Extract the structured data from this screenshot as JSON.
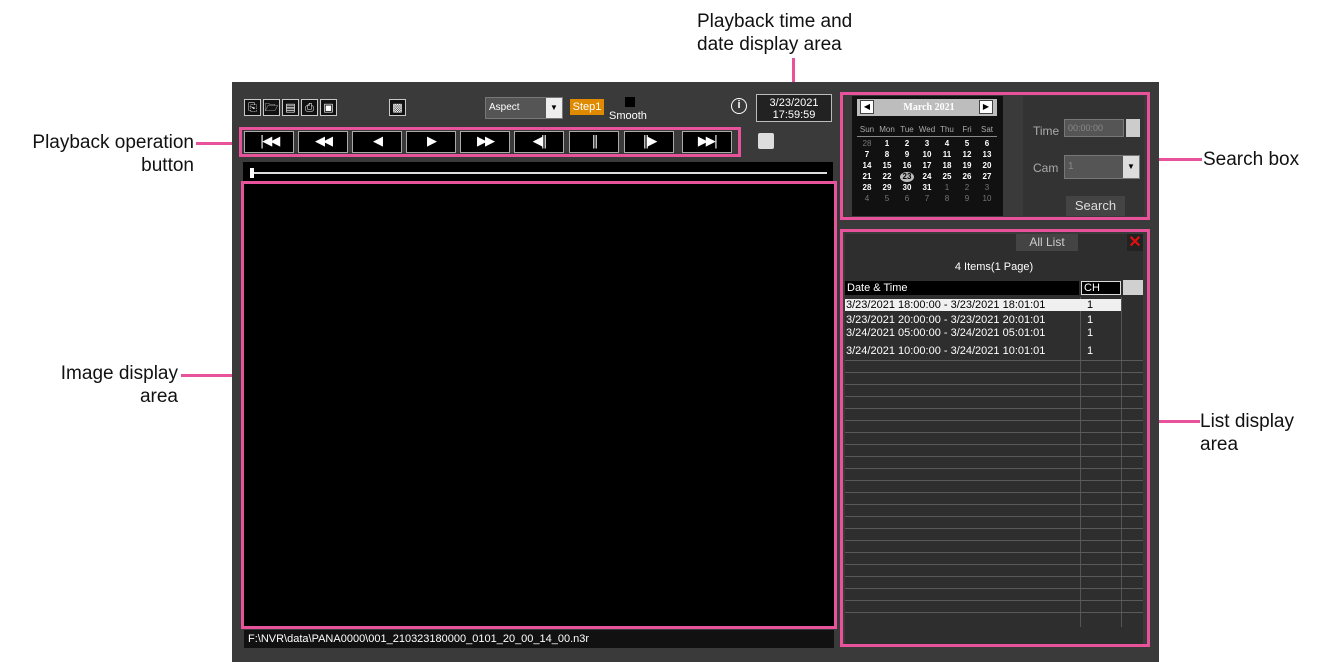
{
  "callouts": {
    "playback_time": [
      "Playback time and",
      "date display area"
    ],
    "playback_operation": [
      "Playback operation",
      "button"
    ],
    "image_display": [
      "Image display",
      "area"
    ],
    "search_box": "Search box",
    "list_display": [
      "List display",
      "area"
    ]
  },
  "toolbar": {
    "aspect_label": "Aspect",
    "step_label": "Step1",
    "smooth_label": "Smooth",
    "icons": [
      "open-recording-icon",
      "open-folder-icon",
      "save-icon",
      "print-icon",
      "fullscreen-icon",
      "snapshot-icon",
      "info-icon"
    ]
  },
  "datetime": {
    "date": "3/23/2021",
    "time": "17:59:59"
  },
  "playback_buttons": [
    "skip-to-start",
    "fast-rewind",
    "reverse-play",
    "play",
    "fast-forward",
    "frame-back",
    "pause",
    "frame-forward",
    "skip-to-end"
  ],
  "file_path": "F:\\NVR\\data\\PANA0000\\001_210323180000_0101_20_00_14_00.n3r",
  "calendar": {
    "month_label": "March 2021",
    "weekdays": [
      "Sun",
      "Mon",
      "Tue",
      "Wed",
      "Thu",
      "Fri",
      "Sat"
    ],
    "weeks": [
      [
        "28",
        "1",
        "2",
        "3",
        "4",
        "5",
        "6"
      ],
      [
        "7",
        "8",
        "9",
        "10",
        "11",
        "12",
        "13"
      ],
      [
        "14",
        "15",
        "16",
        "17",
        "18",
        "19",
        "20"
      ],
      [
        "21",
        "22",
        "23",
        "24",
        "25",
        "26",
        "27"
      ],
      [
        "28",
        "29",
        "30",
        "31",
        "1",
        "2",
        "3"
      ],
      [
        "4",
        "5",
        "6",
        "7",
        "8",
        "9",
        "10"
      ]
    ],
    "selected_day": "23"
  },
  "search": {
    "time_label": "Time",
    "time_value": "00:00:00",
    "cam_label": "Cam",
    "cam_value": "1",
    "search_label": "Search"
  },
  "list": {
    "tab_label": "All List",
    "count_label": "4 Items(1 Page)",
    "col_datetime": "Date & Time",
    "col_ch": "CH",
    "rows": [
      {
        "datetime": "3/23/2021 18:00:00 - 3/23/2021 18:01:01",
        "ch": "1"
      },
      {
        "datetime": "3/23/2021 20:00:00 - 3/23/2021 20:01:01",
        "ch": "1"
      },
      {
        "datetime": "3/24/2021 05:00:00 - 3/24/2021 05:01:01",
        "ch": "1"
      },
      {
        "datetime": "3/24/2021 10:00:00 - 3/24/2021 10:01:01",
        "ch": "1"
      }
    ]
  },
  "colors": {
    "highlight": "#e8529a",
    "step_orange": "#e08a00",
    "close_red": "#e01010"
  }
}
